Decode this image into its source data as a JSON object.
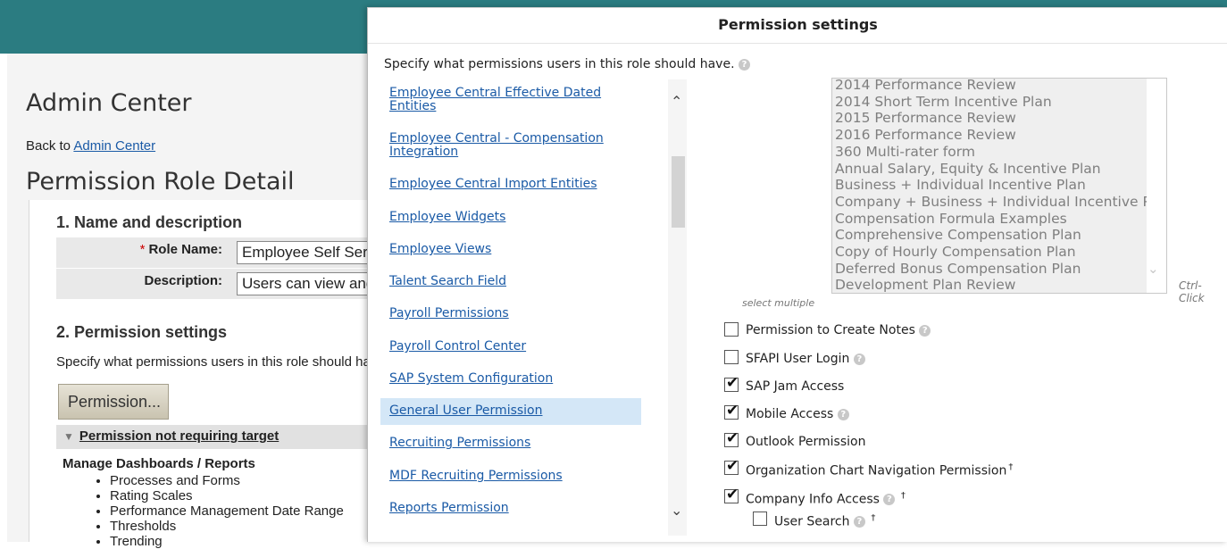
{
  "background": {
    "title": "Admin Center",
    "back_prefix": "Back to",
    "back_link": "Admin Center",
    "page_title": "Permission Role Detail",
    "section1": "1. Name and description",
    "role_name_label": "Role Name:",
    "required_mark": "*",
    "role_name_value": "Employee Self Serv",
    "description_label": "Description:",
    "description_value": "Users can view and",
    "section2": "2. Permission settings",
    "section2_desc": "Specify what permissions users in this role should ha",
    "permission_button": "Permission...",
    "collapse_label": "Permission not requiring target",
    "manage_label": "Manage Dashboards / Reports",
    "manage_items": [
      "Processes and Forms",
      "Rating Scales",
      "Performance Management Date Range",
      "Thresholds",
      "Trending"
    ]
  },
  "modal": {
    "title": "Permission settings",
    "intro": "Specify what permissions users in this role should have.",
    "categories": [
      "Employee Central Effective Dated Entities",
      "Employee Central - Compensation Integration",
      "Employee Central Import Entities",
      "Employee Widgets",
      "Employee Views",
      "Talent Search Field",
      "Payroll Permissions",
      "Payroll Control Center",
      "SAP System Configuration",
      "General User Permission",
      "Recruiting Permissions",
      "MDF Recruiting Permissions",
      "Reports Permission"
    ],
    "selected_category": "General User Permission",
    "listbox_items": [
      "2014 Performance Review",
      "2014 Short Term Incentive Plan",
      "2015 Performance Review",
      "2016 Performance Review",
      "360 Multi-rater form",
      "Annual Salary, Equity & Incentive Plan",
      "Business + Individual Incentive Plan",
      "Company + Business + Individual Incentive Plan",
      "Compensation Formula Examples",
      "Comprehensive Compensation Plan",
      "Copy of Hourly Compensation Plan",
      "Deferred Bonus Compensation Plan",
      "Development Plan Review"
    ],
    "select_multiple_hint": "select multiple",
    "ctrl_click_hint": "Ctrl-Click",
    "permissions": [
      {
        "label": "Permission to Create Notes",
        "checked": false,
        "help": true,
        "dagger": false
      },
      {
        "label": "SFAPI User Login",
        "checked": false,
        "help": true,
        "dagger": false
      },
      {
        "label": "SAP Jam Access",
        "checked": true,
        "help": false,
        "dagger": false
      },
      {
        "label": "Mobile Access",
        "checked": true,
        "help": true,
        "dagger": false
      },
      {
        "label": "Outlook Permission",
        "checked": true,
        "help": false,
        "dagger": false
      },
      {
        "label": "Organization Chart Navigation Permission",
        "checked": true,
        "help": false,
        "dagger": true
      },
      {
        "label": "Company Info Access",
        "checked": true,
        "help": true,
        "dagger": true
      },
      {
        "label": "User Search",
        "checked": false,
        "help": true,
        "dagger": true
      }
    ],
    "dagger_symbol": "†",
    "help_symbol": "?",
    "check_symbol": "✔",
    "scroll_up_symbol": "⌃",
    "scroll_down_symbol": "⌄",
    "listbox_chevron_symbol": "⌄"
  }
}
